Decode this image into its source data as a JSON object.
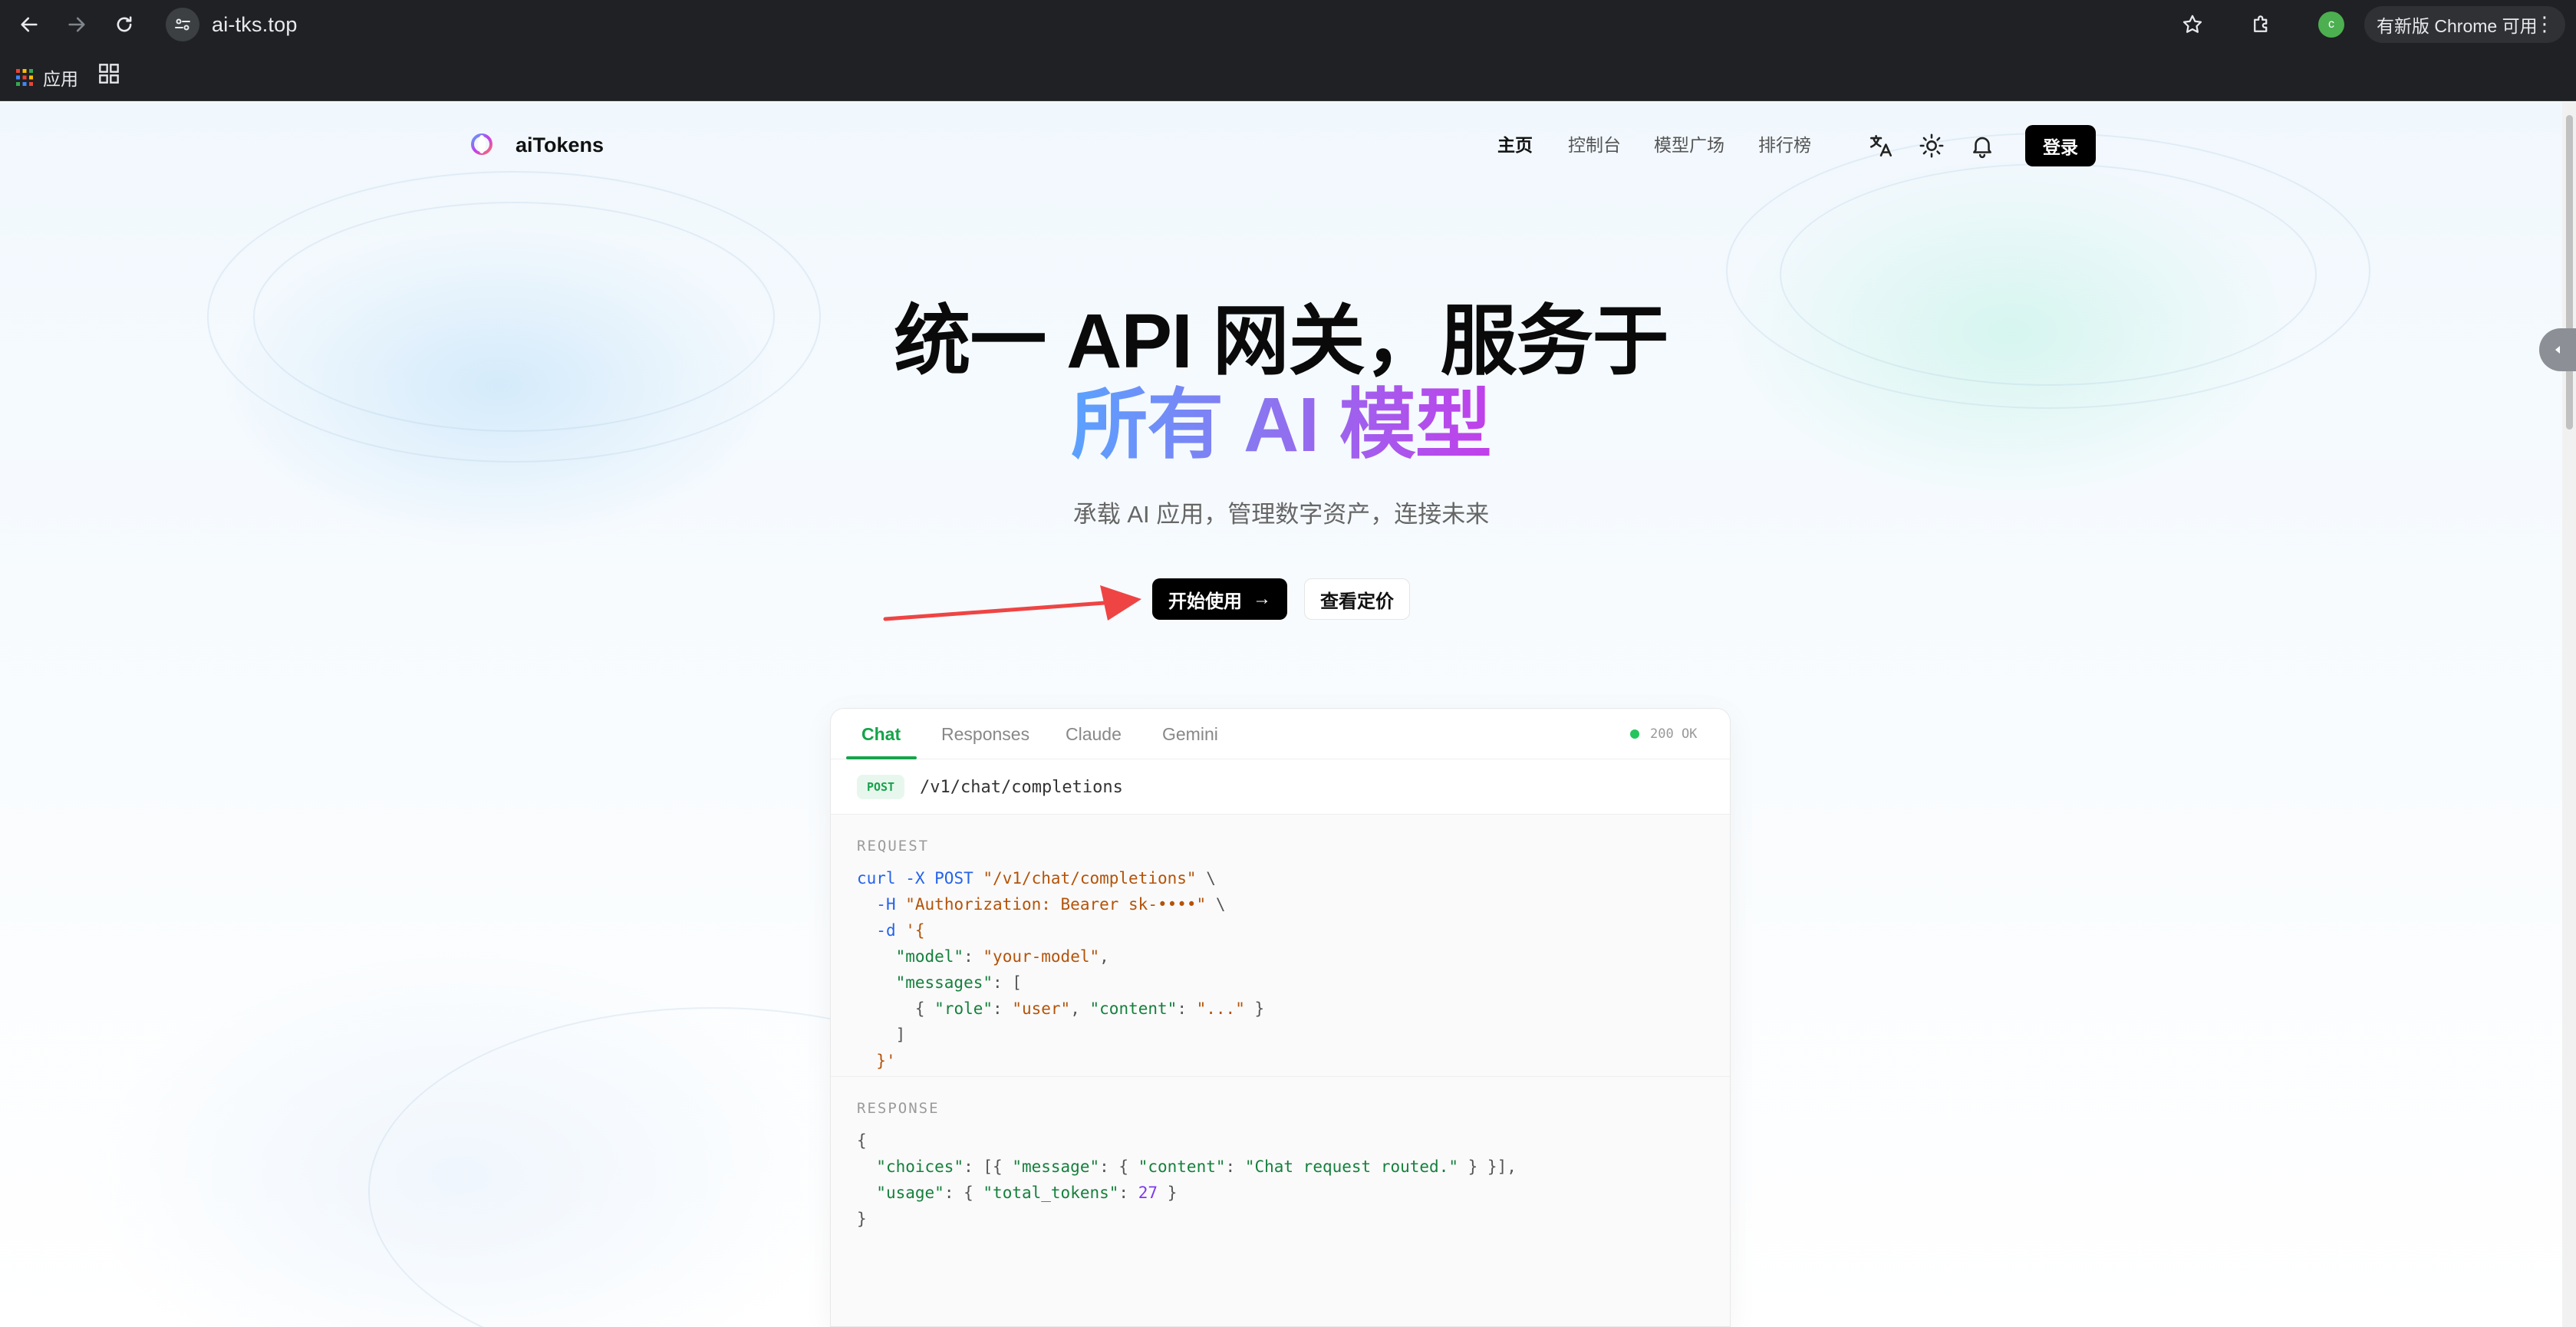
{
  "browser": {
    "url": "ai-tks.top",
    "update_label": "有新版 Chrome 可用",
    "menu_glyph": "⋮",
    "profile_initial": "c",
    "bookmarks_apps_label": "应用"
  },
  "header": {
    "brand": "aiTokens",
    "nav": [
      "主页",
      "控制台",
      "模型广场",
      "排行榜"
    ],
    "login_label": "登录"
  },
  "hero": {
    "title_line1": "统一 API 网关，服务于",
    "title_line2": "所有 AI 模型",
    "subtitle": "承载 AI 应用，管理数字资产，连接未来",
    "primary_button": "开始使用",
    "primary_arrow": "→",
    "secondary_button": "查看定价"
  },
  "code_card": {
    "tabs": [
      "Chat",
      "Responses",
      "Claude",
      "Gemini"
    ],
    "active_tab": "Chat",
    "status": "200 OK",
    "method": "POST",
    "endpoint": "/v1/chat/completions",
    "request_label": "REQUEST",
    "response_label": "RESPONSE"
  },
  "colors": {
    "accent_green": "#16a34a",
    "gradient_start": "#5aa2ff",
    "gradient_end": "#c13fea",
    "annotation_arrow": "#ef4444"
  }
}
